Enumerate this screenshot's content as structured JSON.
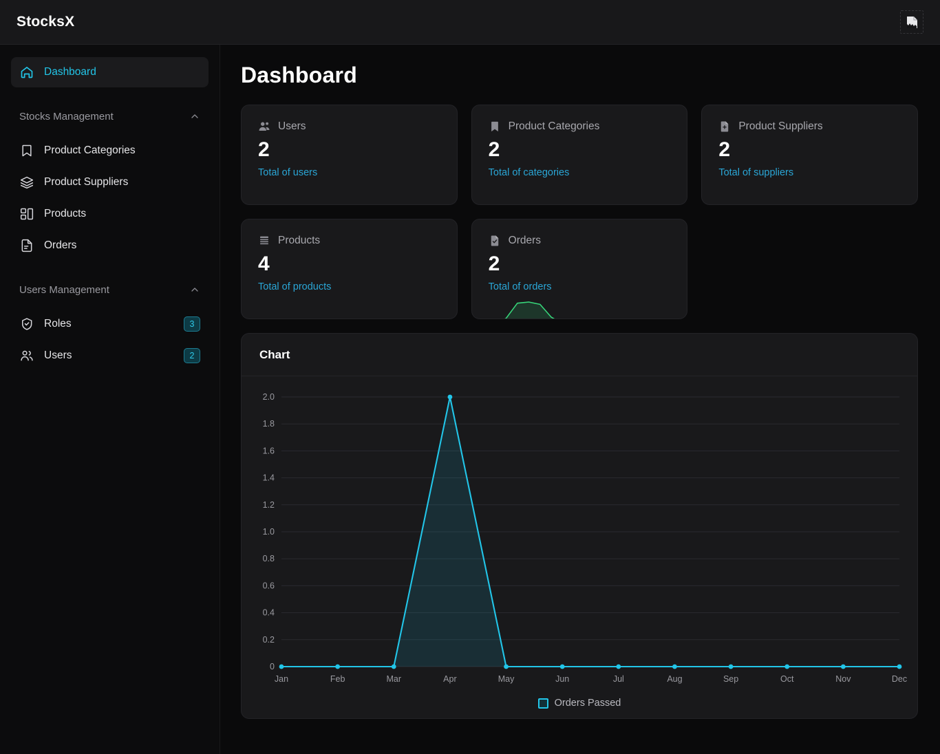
{
  "topbar": {
    "brand": "StocksX",
    "avatar_icon": "broken-image-icon"
  },
  "sidebar": {
    "dashboard": {
      "label": "Dashboard",
      "icon": "home-icon",
      "active": true
    },
    "groups": [
      {
        "label": "Stocks Management",
        "chevron": "chevron-up-icon",
        "items": [
          {
            "label": "Product Categories",
            "icon": "bookmark-icon",
            "badge": ""
          },
          {
            "label": "Product Suppliers",
            "icon": "layers-icon",
            "badge": ""
          },
          {
            "label": "Products",
            "icon": "layout-grid-icon",
            "badge": ""
          },
          {
            "label": "Orders",
            "icon": "file-text-icon",
            "badge": ""
          }
        ]
      },
      {
        "label": "Users Management",
        "chevron": "chevron-up-icon",
        "items": [
          {
            "label": "Roles",
            "icon": "shield-check-icon",
            "badge": "3"
          },
          {
            "label": "Users",
            "icon": "users-icon",
            "badge": "2"
          }
        ]
      }
    ]
  },
  "main": {
    "title": "Dashboard",
    "cards": [
      {
        "title": "Users",
        "icon": "users-icon",
        "value": "2",
        "subtitle": "Total of users",
        "sparkline": false
      },
      {
        "title": "Product Categories",
        "icon": "bookmark-filled-icon",
        "value": "2",
        "subtitle": "Total of categories",
        "sparkline": false
      },
      {
        "title": "Product Suppliers",
        "icon": "file-plus-icon",
        "value": "2",
        "subtitle": "Total of suppliers",
        "sparkline": false
      },
      {
        "title": "Products",
        "icon": "layers-filled-icon",
        "value": "4",
        "subtitle": "Total of products",
        "sparkline": false
      },
      {
        "title": "Orders",
        "icon": "file-check-icon",
        "value": "2",
        "subtitle": "Total of orders",
        "sparkline": true
      }
    ],
    "chart_panel": {
      "title": "Chart"
    }
  },
  "colors": {
    "accent": "#22c5e8",
    "link": "#2aa6d6",
    "card_bg": "#19191b",
    "page_bg": "#0a0a0b",
    "sparkline_green": "#37d67a",
    "badge_text": "#2fc9e8"
  },
  "chart_data": {
    "type": "line",
    "title": "Chart",
    "xlabel": "",
    "ylabel": "",
    "categories": [
      "Jan",
      "Feb",
      "Mar",
      "Apr",
      "May",
      "Jun",
      "Jul",
      "Aug",
      "Sep",
      "Oct",
      "Nov",
      "Dec"
    ],
    "series": [
      {
        "name": "Orders Passed",
        "values": [
          0,
          0,
          0,
          2,
          0,
          0,
          0,
          0,
          0,
          0,
          0,
          0
        ],
        "color": "#22c5e8",
        "fill": true,
        "markers": true
      }
    ],
    "yticks": [
      "0",
      "0.2",
      "0.4",
      "0.6",
      "0.8",
      "1.0",
      "1.2",
      "1.4",
      "1.6",
      "1.8",
      "2.0"
    ],
    "ytick_values": [
      0,
      0.2,
      0.4,
      0.6,
      0.8,
      1.0,
      1.2,
      1.4,
      1.6,
      1.8,
      2.0
    ],
    "ylim": [
      0,
      2.0
    ],
    "grid": true,
    "legend_position": "bottom",
    "legend": [
      "Orders Passed"
    ]
  },
  "orders_sparkline": {
    "color": "#37d67a",
    "values": [
      0,
      0,
      0.05,
      0.3,
      0.95,
      1.0,
      0.9,
      0.35,
      0.07,
      0,
      0,
      0,
      0,
      0,
      0,
      0,
      0,
      0,
      0,
      0
    ]
  }
}
